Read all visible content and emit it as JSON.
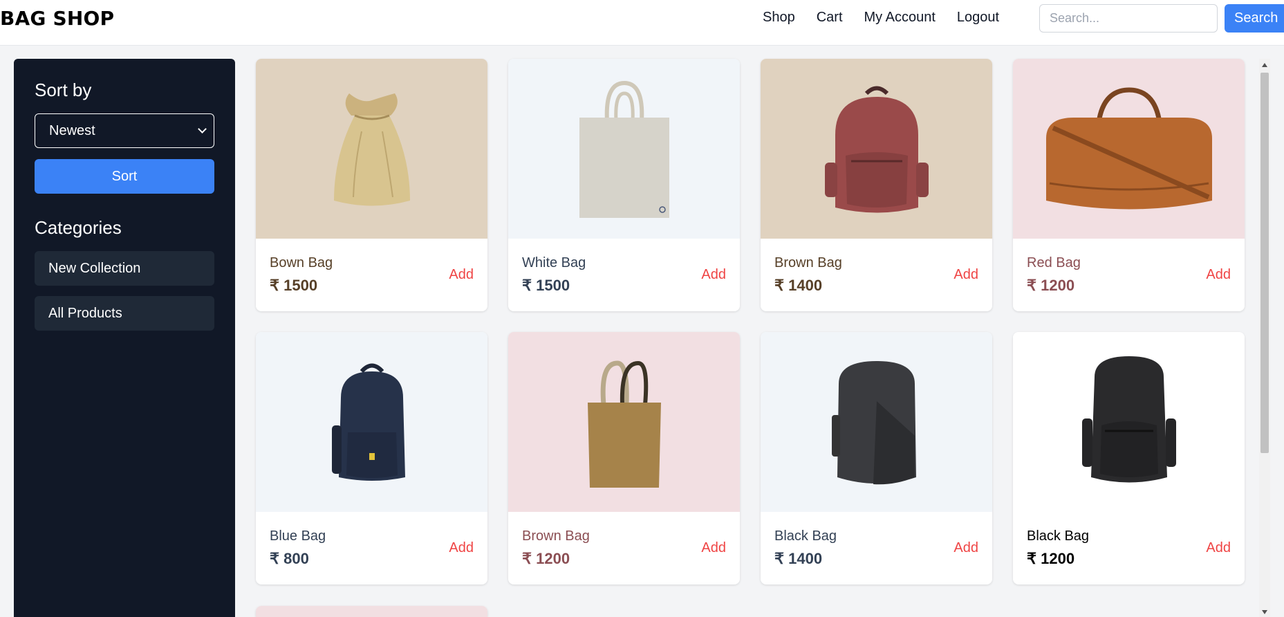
{
  "header": {
    "brand": "BAG SHOP",
    "nav": [
      "Shop",
      "Cart",
      "My Account",
      "Logout"
    ],
    "search_placeholder": "Search...",
    "search_button": "Search"
  },
  "sidebar": {
    "sort_title": "Sort by",
    "sort_selected": "Newest",
    "sort_button": "Sort",
    "categories_title": "Categories",
    "categories": [
      "New Collection",
      "All Products"
    ]
  },
  "products": [
    {
      "name": "Bown Bag",
      "price": "₹ 1500",
      "add": "Add",
      "bg": "#e0d2bf",
      "text_color": "#574028",
      "icon": "jute-pouch-icon"
    },
    {
      "name": "White Bag",
      "price": "₹ 1500",
      "add": "Add",
      "bg": "#f1f5f9",
      "text_color": "#334155",
      "icon": "tote-bag-icon"
    },
    {
      "name": "Brown Bag",
      "price": "₹ 1400",
      "add": "Add",
      "bg": "#e0d2bf",
      "text_color": "#574028",
      "icon": "backpack-icon"
    },
    {
      "name": "Red Bag",
      "price": "₹ 1200",
      "add": "Add",
      "bg": "#f2dfe2",
      "text_color": "#8b4e53",
      "icon": "duffel-bag-icon"
    },
    {
      "name": "Blue Bag",
      "price": "₹ 800",
      "add": "Add",
      "bg": "#f1f5f9",
      "text_color": "#334155",
      "icon": "backpack-icon"
    },
    {
      "name": "Brown Bag",
      "price": "₹ 1200",
      "add": "Add",
      "bg": "#f2dfe2",
      "text_color": "#8b4e53",
      "icon": "tote-bag-icon"
    },
    {
      "name": "Black Bag",
      "price": "₹ 1400",
      "add": "Add",
      "bg": "#f1f5f9",
      "text_color": "#334155",
      "icon": "backpack-icon"
    },
    {
      "name": "Black Bag",
      "price": "₹ 1200",
      "add": "Add",
      "bg": "#ffffff",
      "text_color": "#000000",
      "icon": "backpack-icon"
    },
    {
      "name": "",
      "price": "",
      "add": "",
      "bg": "#f2dfe2",
      "text_color": "#8b4e53",
      "icon": ""
    }
  ],
  "colors": {
    "accent": "#3b82f6",
    "sidebar_bg": "#111827",
    "sidebar_item_bg": "#1f2937",
    "add_link": "#ef4444"
  }
}
